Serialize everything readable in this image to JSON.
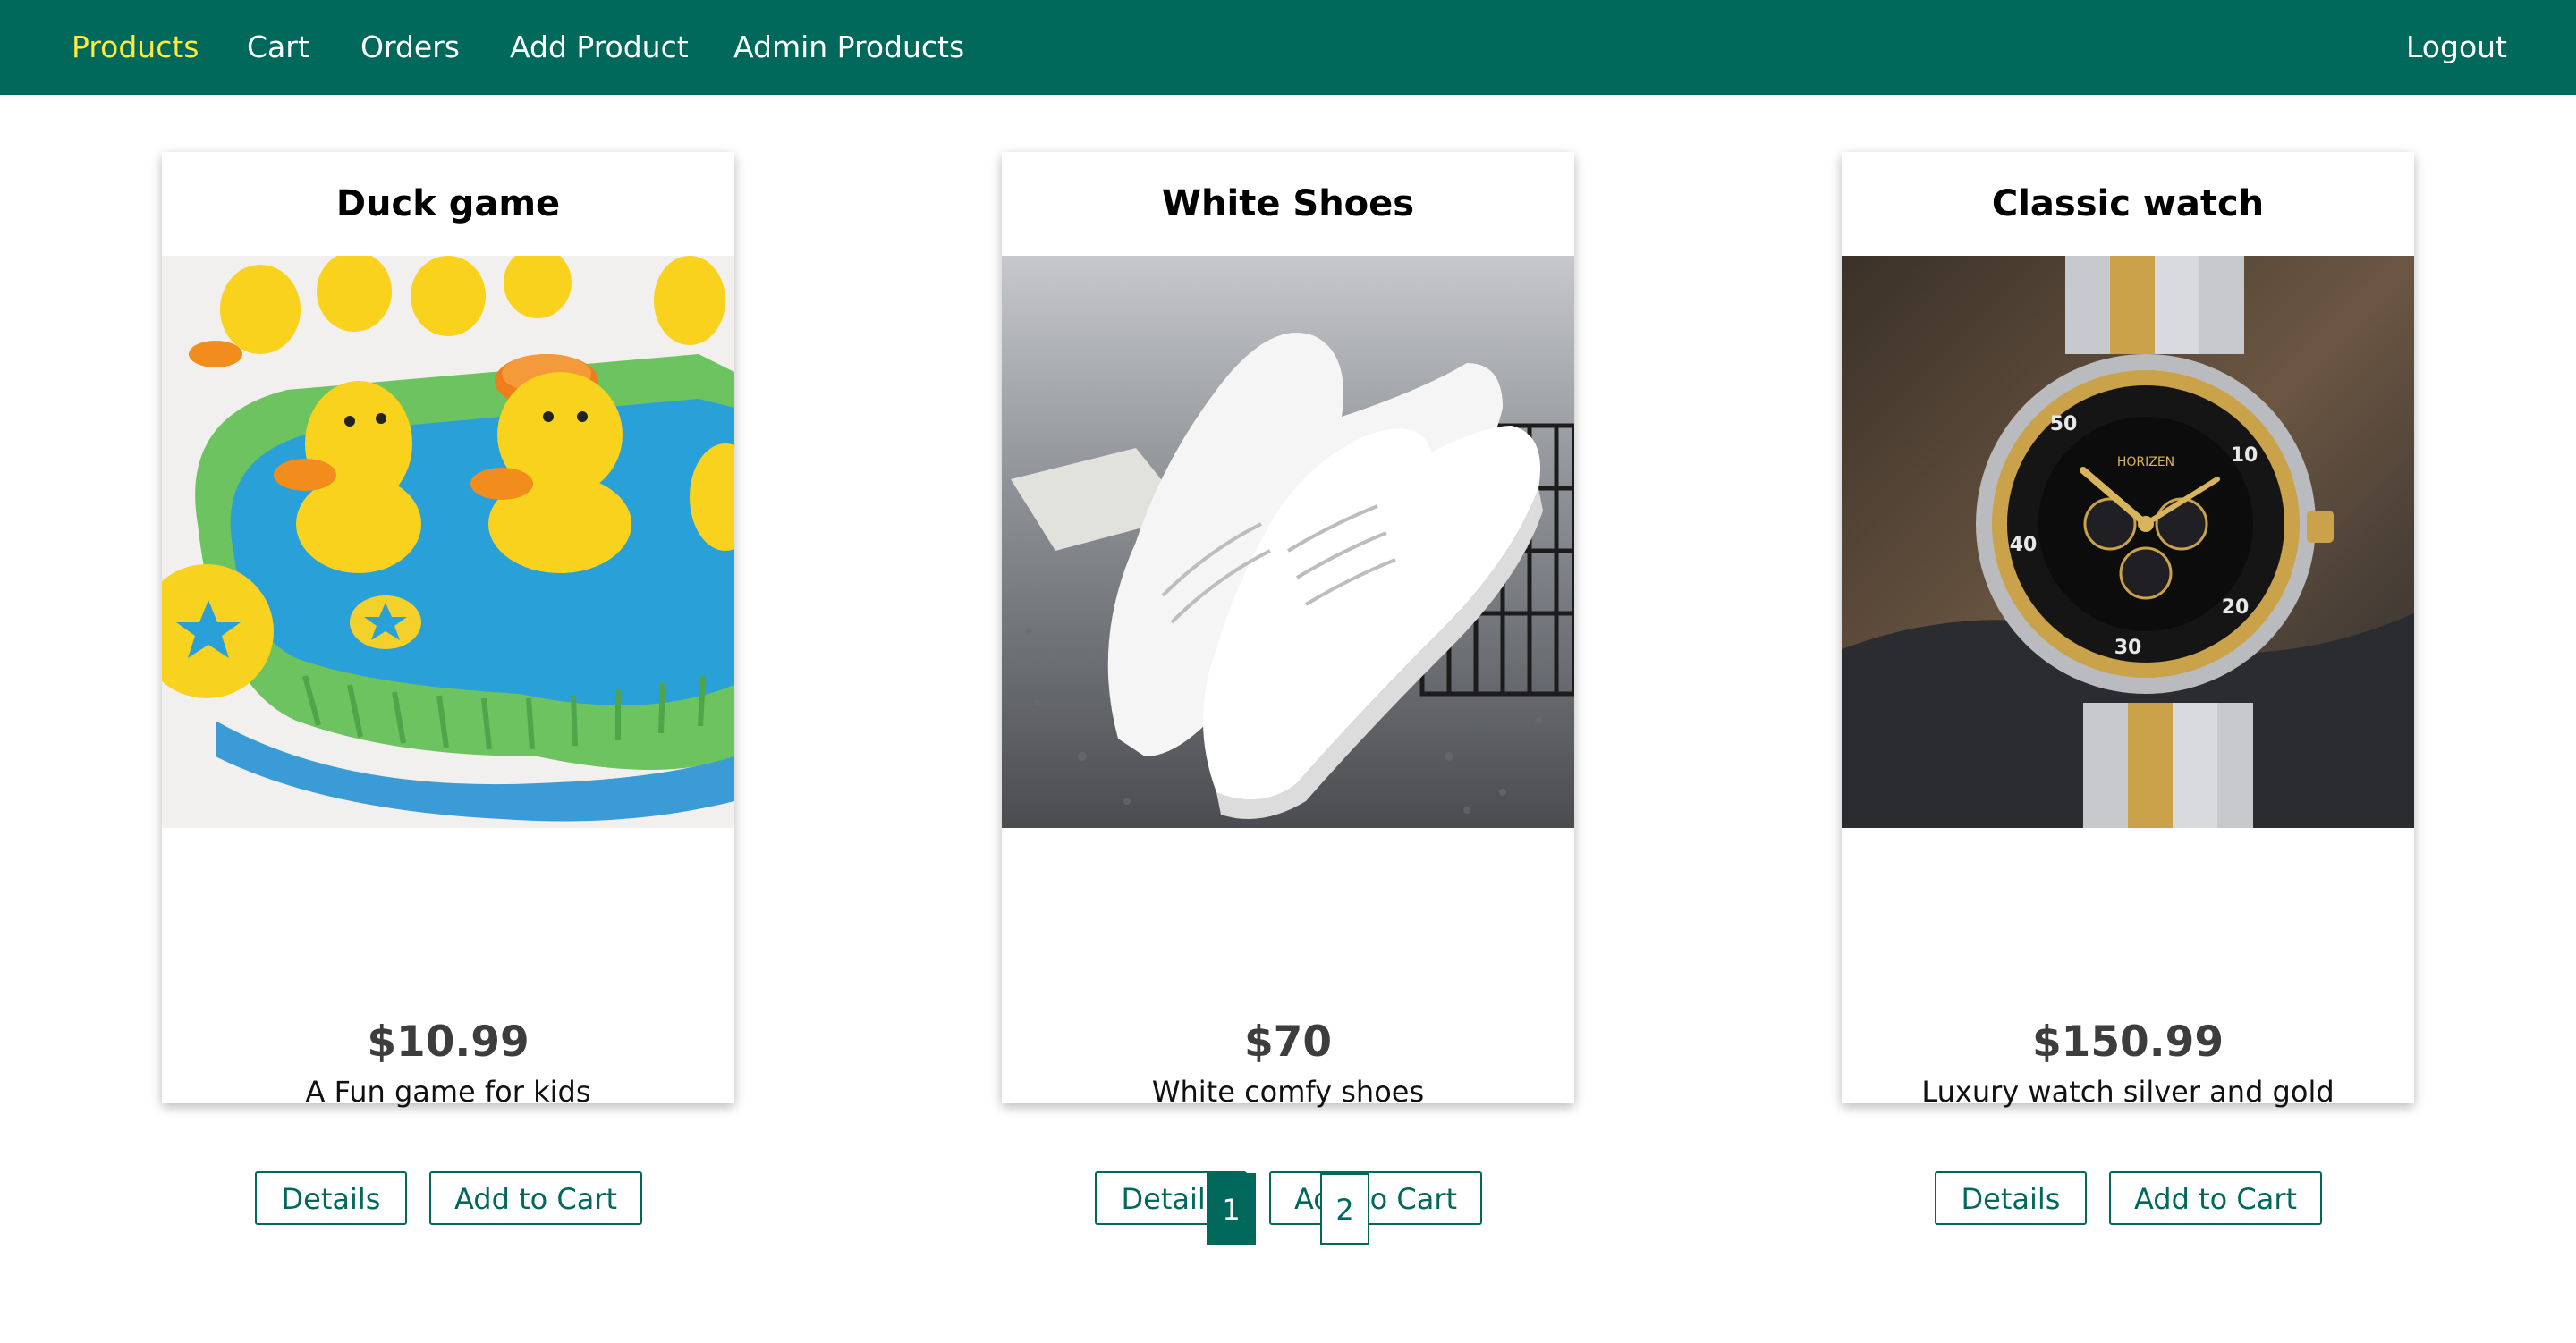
{
  "nav": {
    "items": [
      {
        "label": "Products",
        "active": true
      },
      {
        "label": "Cart",
        "active": false
      },
      {
        "label": "Orders",
        "active": false
      },
      {
        "label": "Add Product",
        "active": false
      },
      {
        "label": "Admin Products",
        "active": false
      }
    ],
    "logout_label": "Logout"
  },
  "products": [
    {
      "title": "Duck game",
      "price": "$10.99",
      "description": "A Fun game for kids",
      "image": "duck-game-photo",
      "details_label": "Details",
      "add_to_cart_label": "Add to Cart"
    },
    {
      "title": "White Shoes",
      "price": "$70",
      "description": "White comfy shoes",
      "image": "white-shoes-photo",
      "details_label": "Details",
      "add_to_cart_label": "Add to Cart"
    },
    {
      "title": "Classic watch",
      "price": "$150.99",
      "description": "Luxury watch silver and gold",
      "image": "classic-watch-photo",
      "details_label": "Details",
      "add_to_cart_label": "Add to Cart"
    }
  ],
  "pagination": {
    "pages": [
      "1",
      "2"
    ],
    "current": "1"
  },
  "colors": {
    "primary": "#00695c",
    "active_nav": "#ffeb3b",
    "price_text": "#3d3d3d"
  }
}
